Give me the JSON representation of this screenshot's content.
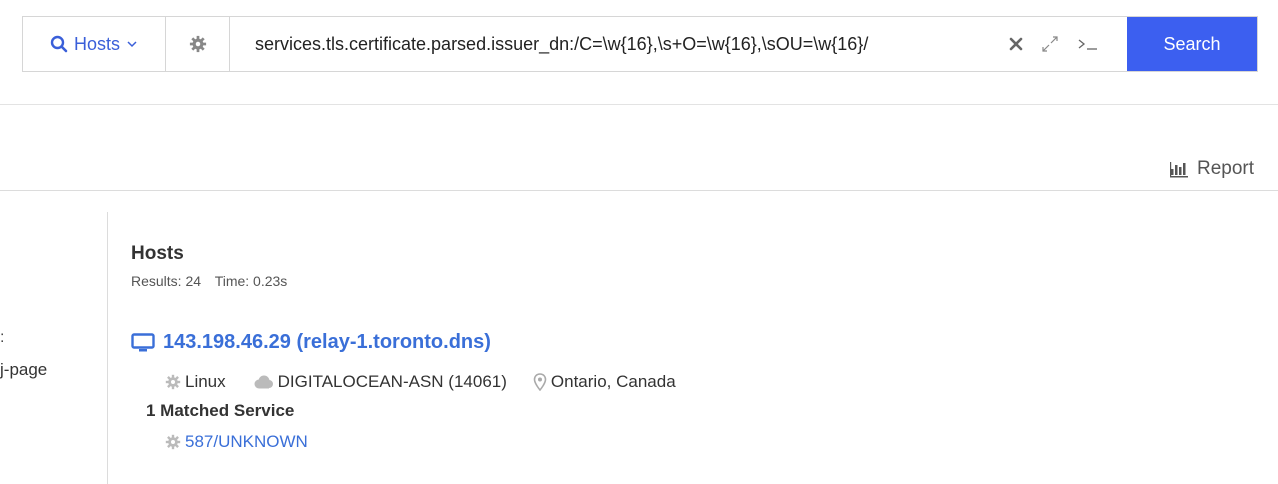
{
  "search": {
    "index_label": "Hosts",
    "query": "services.tls.certificate.parsed.issuer_dn:/C=\\w{16},\\s+O=\\w{16},\\sOU=\\w{16}/",
    "search_label": "Search"
  },
  "toolbar": {
    "report_label": "Report"
  },
  "left_fragments": {
    "line1": ":",
    "line2": "j-page"
  },
  "results": {
    "title": "Hosts",
    "results_count": "Results: 24",
    "time": "Time: 0.23s",
    "hosts": [
      {
        "link": "143.198.46.29 (relay-1.toronto.dns)",
        "os": "Linux",
        "asn": "DIGITALOCEAN-ASN (14061)",
        "location": "Ontario, Canada",
        "matched": "1 Matched Service",
        "service": "587/UNKNOWN"
      }
    ]
  },
  "colors": {
    "accent": "#3c5ff0",
    "link": "#3a6fd8"
  }
}
